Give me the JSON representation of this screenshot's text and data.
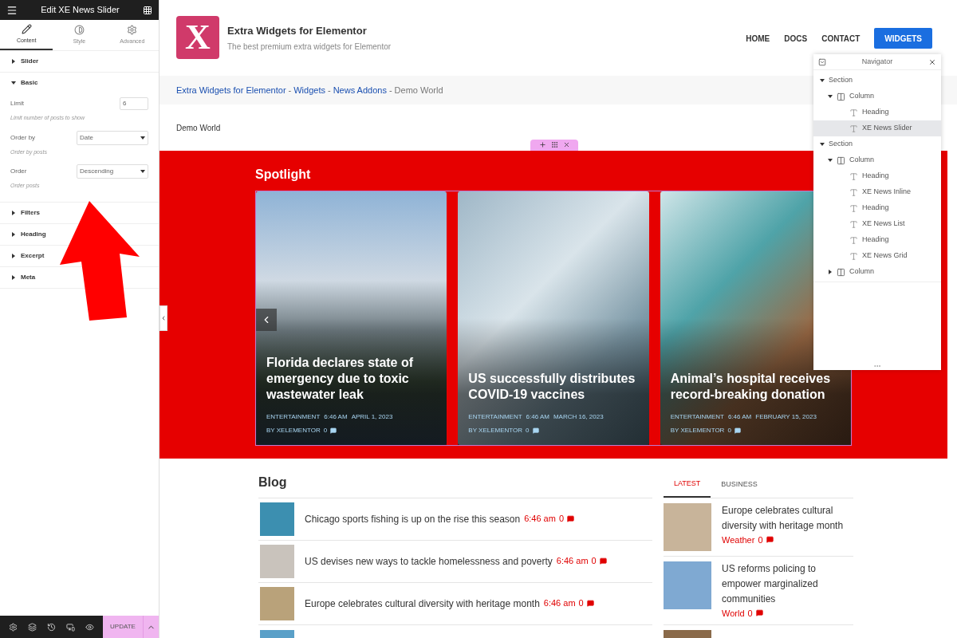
{
  "editor_panel": {
    "title": "Edit XE News Slider",
    "tabs": [
      {
        "label": "Content",
        "selected": true
      },
      {
        "label": "Style",
        "selected": false
      },
      {
        "label": "Advanced",
        "selected": false
      }
    ],
    "sections": [
      {
        "title": "Slider",
        "expanded": false
      },
      {
        "title": "Basic",
        "expanded": true,
        "controls": [
          {
            "kind": "number",
            "label": "Limit",
            "value": "6",
            "help": "Limit number of posts to show"
          },
          {
            "kind": "select",
            "label": "Order by",
            "value": "Date",
            "help": "Order by posts"
          },
          {
            "kind": "select",
            "label": "Order",
            "value": "Descending",
            "help": "Order posts"
          }
        ]
      },
      {
        "title": "Filters",
        "expanded": false
      },
      {
        "title": "Heading",
        "expanded": false
      },
      {
        "title": "Excerpt",
        "expanded": false
      },
      {
        "title": "Meta",
        "expanded": false
      }
    ],
    "update_label": "UPDATE"
  },
  "site_header": {
    "logo_letter": "X",
    "title": "Extra Widgets for Elementor",
    "tagline": "The best premium extra widgets for Elementor",
    "nav": [
      {
        "label": "HOME",
        "kind": "link"
      },
      {
        "label": "DOCS",
        "kind": "link"
      },
      {
        "label": "CONTACT",
        "kind": "link"
      },
      {
        "label": "WIDGETS",
        "kind": "button"
      }
    ]
  },
  "breadcrumb": {
    "separator": "-",
    "items": [
      {
        "text": "Extra Widgets for Elementor",
        "kind": "link"
      },
      {
        "text": "Widgets",
        "kind": "link"
      },
      {
        "text": "News Addons",
        "kind": "link"
      },
      {
        "text": "Demo World",
        "kind": "current"
      }
    ]
  },
  "page_title": "Demo World",
  "spotlight": {
    "heading": "Spotlight",
    "slides": [
      {
        "title": "Florida declares state of emergency due to toxic wastewater leak",
        "category": "ENTERTAINMENT",
        "time": "6:46 AM",
        "date": "APRIL 1, 2023",
        "author": "BY XELEMENTOR",
        "comments": "0"
      },
      {
        "title": "US successfully distributes COVID-19 vaccines",
        "category": "ENTERTAINMENT",
        "time": "6:46 AM",
        "date": "MARCH 16, 2023",
        "author": "BY XELEMENTOR",
        "comments": "0"
      },
      {
        "title": "Animal’s hospital receives record-breaking donation",
        "category": "ENTERTAINMENT",
        "time": "6:46 AM",
        "date": "FEBRUARY 15, 2023",
        "author": "BY XELEMENTOR",
        "comments": "0"
      }
    ]
  },
  "blog": {
    "heading": "Blog",
    "posts": [
      {
        "title": "Chicago sports fishing is up on the rise this season",
        "time": "6:46 am",
        "comments": "0"
      },
      {
        "title": "US devises new ways to tackle homelessness and poverty",
        "time": "6:46 am",
        "comments": "0"
      },
      {
        "title": "Europe celebrates cultural diversity with heritage month",
        "time": "6:46 am",
        "comments": "0"
      }
    ]
  },
  "side_tabs": [
    {
      "label": "LATEST",
      "selected": true
    },
    {
      "label": "BUSINESS",
      "selected": false
    }
  ],
  "side_posts": [
    {
      "title": "Europe celebrates cultural diversity with heritage month",
      "category": "Weather",
      "comments": "0"
    },
    {
      "title": "US reforms policing to empower marginalized communities",
      "category": "World",
      "comments": "0"
    }
  ],
  "navigator": {
    "title": "Navigator",
    "tree": [
      {
        "label": "Section",
        "kind": "section",
        "expanded": true,
        "selected": false,
        "children": [
          {
            "label": "Column",
            "kind": "column",
            "expanded": true,
            "selected": false,
            "children": [
              {
                "label": "Heading",
                "kind": "widget",
                "selected": false
              },
              {
                "label": "XE News Slider",
                "kind": "widget",
                "selected": true
              }
            ]
          }
        ]
      },
      {
        "label": "Section",
        "kind": "section",
        "expanded": true,
        "selected": false,
        "children": [
          {
            "label": "Column",
            "kind": "column",
            "expanded": true,
            "selected": false,
            "children": [
              {
                "label": "Heading",
                "kind": "widget",
                "selected": false
              },
              {
                "label": "XE News Inline",
                "kind": "widget",
                "selected": false
              },
              {
                "label": "Heading",
                "kind": "widget",
                "selected": false
              },
              {
                "label": "XE News List",
                "kind": "widget",
                "selected": false
              },
              {
                "label": "Heading",
                "kind": "widget",
                "selected": false
              },
              {
                "label": "XE News Grid",
                "kind": "widget",
                "selected": false
              }
            ]
          },
          {
            "label": "Column",
            "kind": "column",
            "expanded": false,
            "selected": false
          }
        ]
      }
    ]
  }
}
